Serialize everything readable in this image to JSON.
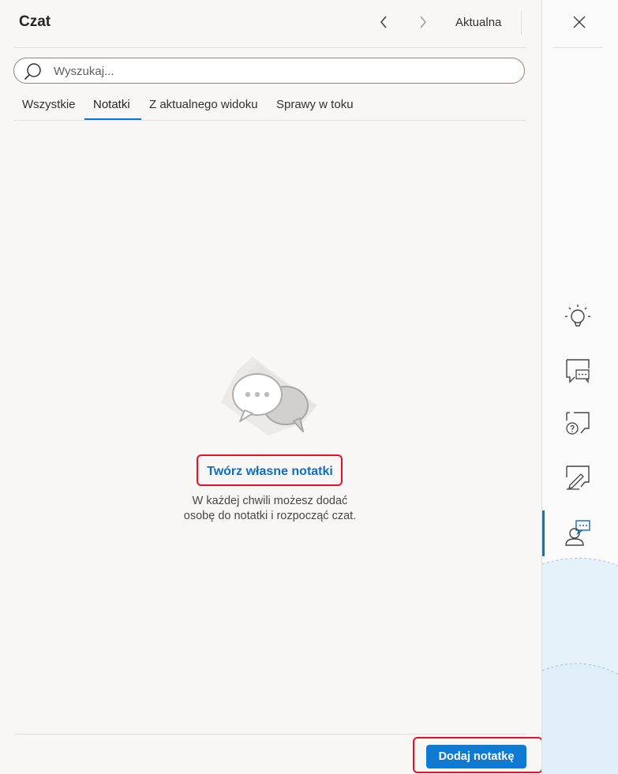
{
  "header": {
    "title": "Czat",
    "current_label": "Aktualna"
  },
  "search": {
    "placeholder": "Wyszukaj..."
  },
  "tabs": [
    {
      "label": "Wszystkie",
      "selected": false
    },
    {
      "label": "Notatki",
      "selected": true
    },
    {
      "label": "Z aktualnego widoku",
      "selected": false
    },
    {
      "label": "Sprawy w toku",
      "selected": false
    }
  ],
  "empty_state": {
    "illustration": "chat-bubbles-icon",
    "title": "Twórz własne notatki",
    "description_line1": "W każdej chwili możesz dodać",
    "description_line2": "osobę do notatki i rozpocząć czat."
  },
  "footer": {
    "add_button": "Dodaj notatkę"
  },
  "rail": {
    "icons": [
      "lightbulb-icon",
      "chat-icon",
      "question-chat-icon",
      "edit-note-icon",
      "contact-chat-icon"
    ],
    "active": "contact-chat-icon"
  },
  "colors": {
    "accent": "#0078d4",
    "button": "#0f7ad1",
    "highlight": "#e81123",
    "link_title": "#106ebe"
  }
}
